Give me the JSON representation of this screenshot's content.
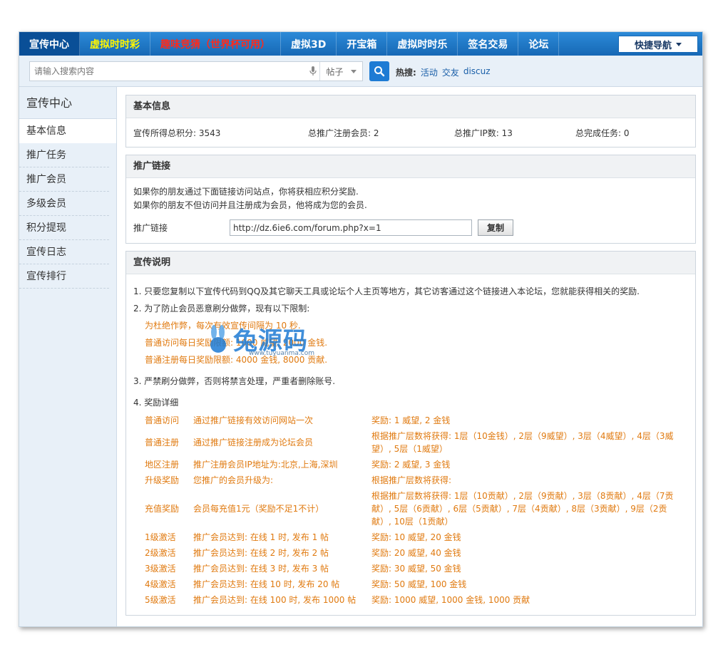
{
  "nav": {
    "items": [
      {
        "label": "宣传中心",
        "style": "active"
      },
      {
        "label": "虚拟时时彩",
        "style": "yellow"
      },
      {
        "label": "趣味竞猜（世界杯可用）",
        "style": "red"
      },
      {
        "label": "虚拟3D",
        "style": "normal"
      },
      {
        "label": "开宝箱",
        "style": "normal"
      },
      {
        "label": "虚拟时时乐",
        "style": "normal"
      },
      {
        "label": "签名交易",
        "style": "normal"
      },
      {
        "label": "论坛",
        "style": "normal"
      }
    ],
    "quick_nav": "快捷导航"
  },
  "search": {
    "placeholder": "请输入搜索内容",
    "type": "帖子",
    "hot_label": "热搜:",
    "hot_links": [
      "活动",
      "交友",
      "discuz"
    ]
  },
  "sidebar": {
    "title": "宣传中心",
    "items": [
      "基本信息",
      "推广任务",
      "推广会员",
      "多级会员",
      "积分提现",
      "宣传日志",
      "宣传排行"
    ]
  },
  "basic": {
    "title": "基本信息",
    "total_points": "宣传所得总积分: 3543",
    "total_members": "总推广注册会员: 2",
    "total_ip": "总推广IP数: 13",
    "total_tasks": "总完成任务: 0"
  },
  "promo_link": {
    "title": "推广链接",
    "line1": "如果你的朋友通过下面链接访问站点，你将获相应积分奖励.",
    "line2": "如果你的朋友不但访问并且注册成为会员，他将成为您的会员.",
    "label": "推广链接",
    "url": "http://dz.6ie6.com/forum.php?x=1",
    "copy": "复制"
  },
  "desc": {
    "title": "宣传说明",
    "p1": "1. 只要您复制以下宣传代码到QQ及其它聊天工具或论坛个人主页等地方，其它访客通过这个链接进入本论坛，您就能获得相关的奖励.",
    "p2": "2. 为了防止会员恶意刷分做弊，现有以下限制:",
    "p2a": "为杜绝作弊，每次有效宣传间隔为 10 秒.",
    "p2b": "普通访问每日奖励限额: 1000 威望, 2000 金钱.",
    "p2c": "普通注册每日奖励限额: 4000 金钱, 8000 贡献.",
    "p3": "3. 严禁刷分做弊，否则将禁言处理，严重者删除账号.",
    "p4": "4. 奖励详细",
    "rewards": [
      {
        "type": "普通访问",
        "cond": "通过推广链接有效访问网站一次",
        "reward": "奖励: 1 威望, 2 金钱"
      },
      {
        "type": "普通注册",
        "cond": "通过推广链接注册成为论坛会员",
        "reward": "根据推广层数将获得: 1层（10金钱）, 2层（9威望）, 3层（4威望）, 4层（3威望）, 5层（1威望）"
      },
      {
        "type": "地区注册",
        "cond": "推广注册会员IP地址为:北京,上海,深圳",
        "reward": "奖励: 2 威望, 3 金钱"
      },
      {
        "type": "升级奖励",
        "cond": "您推广的会员升级为:",
        "reward": "根据推广层数将获得:"
      },
      {
        "type": "充值奖励",
        "cond": "会员每充值1元（奖励不足1不计）",
        "reward": "根据推广层数将获得: 1层（10贡献）, 2层（9贡献）, 3层（8贡献）, 4层（7贡献）, 5层（6贡献）, 6层（5贡献）, 7层（4贡献）, 8层（3贡献）, 9层（2贡献）, 10层（1贡献）"
      },
      {
        "type": "1级激活",
        "cond": "推广会员达到: 在线 1 时, 发布 1 帖",
        "reward": "奖励: 10 威望, 20 金钱"
      },
      {
        "type": "2级激活",
        "cond": "推广会员达到: 在线 2 时, 发布 2 帖",
        "reward": "奖励: 20 威望, 40 金钱"
      },
      {
        "type": "3级激活",
        "cond": "推广会员达到: 在线 3 时, 发布 3 帖",
        "reward": "奖励: 30 威望, 50 金钱"
      },
      {
        "type": "4级激活",
        "cond": "推广会员达到: 在线 10 时, 发布 20 帖",
        "reward": "奖励: 50 威望, 100 金钱"
      },
      {
        "type": "5级激活",
        "cond": "推广会员达到: 在线 100 时, 发布 1000 帖",
        "reward": "奖励: 1000 威望, 1000 金钱, 1000 贡献"
      }
    ]
  },
  "watermark": {
    "text": "兔源码",
    "url": "www.tuyuanma.com"
  },
  "colors": {
    "nav_blue": "#1668b5",
    "orange": "#e07a10",
    "red": "#c8380a"
  }
}
